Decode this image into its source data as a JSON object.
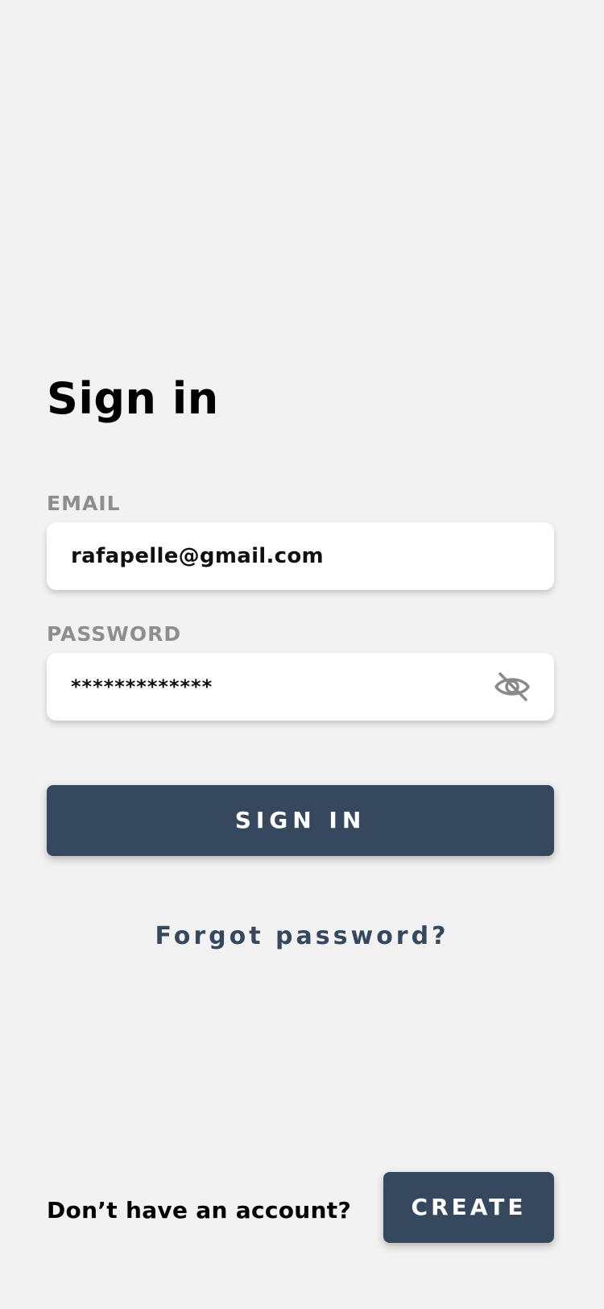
{
  "page": {
    "title": "Sign in"
  },
  "email": {
    "label": "EMAIL",
    "value": "rafapelle@gmail.com"
  },
  "password": {
    "label": "PASSWORD",
    "value": "*************",
    "toggle_icon": "eye-slash-icon"
  },
  "actions": {
    "sign_in_label": "SIGN IN",
    "forgot_label": "Forgot password?"
  },
  "footer": {
    "prompt": "Don’t have an account?",
    "create_label": "CREATE"
  },
  "colors": {
    "background": "#f2f2f3",
    "primary": "#35485e",
    "label_gray": "#8e8e8e",
    "field_bg": "#ffffff",
    "icon_gray": "#8a8a8a"
  }
}
